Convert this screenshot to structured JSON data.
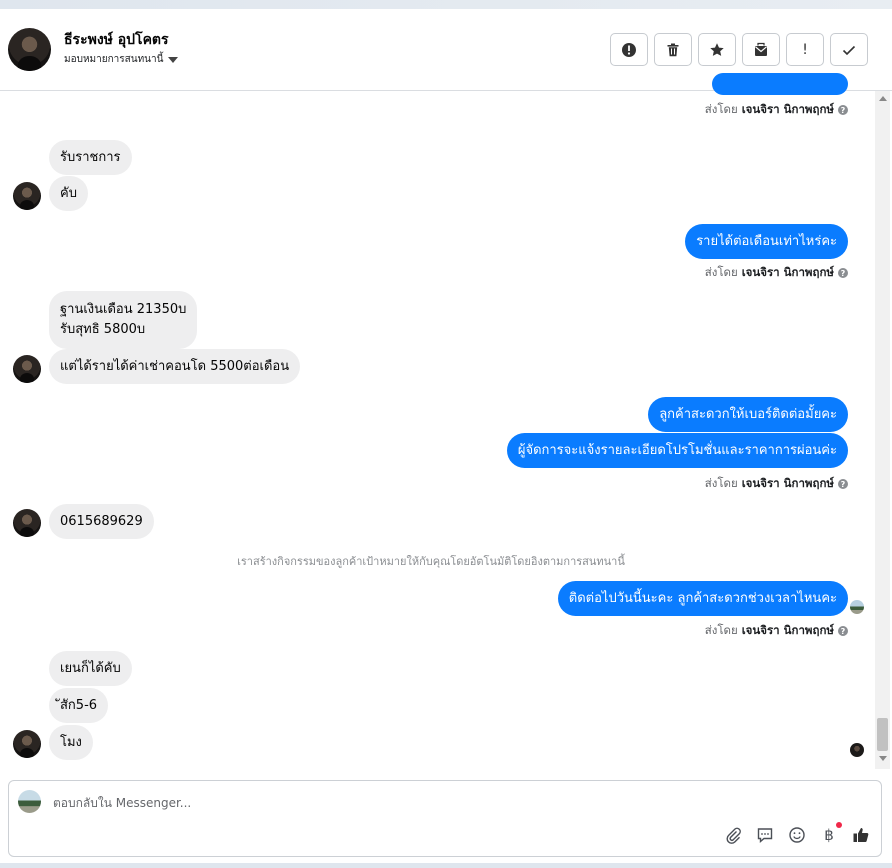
{
  "header": {
    "contact_name": "ธีระพงษ์ อุปโคตร",
    "assign_label": "มอบหมายการสนทนานี้",
    "actions": [
      {
        "name": "spam-button",
        "icon": "exclamation-circle-icon"
      },
      {
        "name": "delete-button",
        "icon": "trash-icon"
      },
      {
        "name": "star-button",
        "icon": "star-icon"
      },
      {
        "name": "mark-unread-button",
        "icon": "envelope-icon"
      },
      {
        "name": "follow-up-button",
        "label": "!"
      },
      {
        "name": "mark-done-button",
        "icon": "check-icon"
      }
    ]
  },
  "conversation": {
    "sender_prefix": "ส่งโดย",
    "agent_name": "เจนจิรา นิกาพฤกษ์",
    "info_glyph": "?",
    "messages": {
      "m1": "รับราชการ",
      "m2": "คับ",
      "m3": "รายได้ต่อเดือนเท่าไหร่คะ",
      "m4a": "ฐานเงินเดือน 21350บ",
      "m4b": "รับสุทธิ 5800บ",
      "m5": "แต่ได้รายได้ค่าเช่าคอนโด 5500ต่อเดือน",
      "m6": "ลูกค้าสะดวกให้เบอร์ติดต่อมั้ยคะ",
      "m7": "ผู้จัดการจะแจ้งรายละเอียดโปรโมชั่นและราคาการผ่อนค่ะ",
      "m8": "0615689629",
      "system": "เราสร้างกิจกรรมของลูกค้าเป้าหมายให้กับคุณโดยอัตโนมัติโดยอิงตามการสนทนานี้",
      "m9": "ติดต่อไปวันนี้นะคะ ลูกค้าสะดวกช่วงเวลาไหนคะ",
      "m10": "เยนก็ได้คับ",
      "m11": "ัสัก5-6",
      "m12": "โมง"
    }
  },
  "composer": {
    "placeholder": "ตอบกลับใน Messenger...",
    "tools": [
      "paperclip-icon",
      "saved-reply-icon",
      "emoji-icon",
      "baht-icon",
      "like-icon"
    ],
    "baht_glyph": "฿"
  },
  "colors": {
    "outgoing_bubble": "#0a7cff",
    "incoming_bubble": "#eeeeef",
    "notification_dot": "#f02849"
  }
}
